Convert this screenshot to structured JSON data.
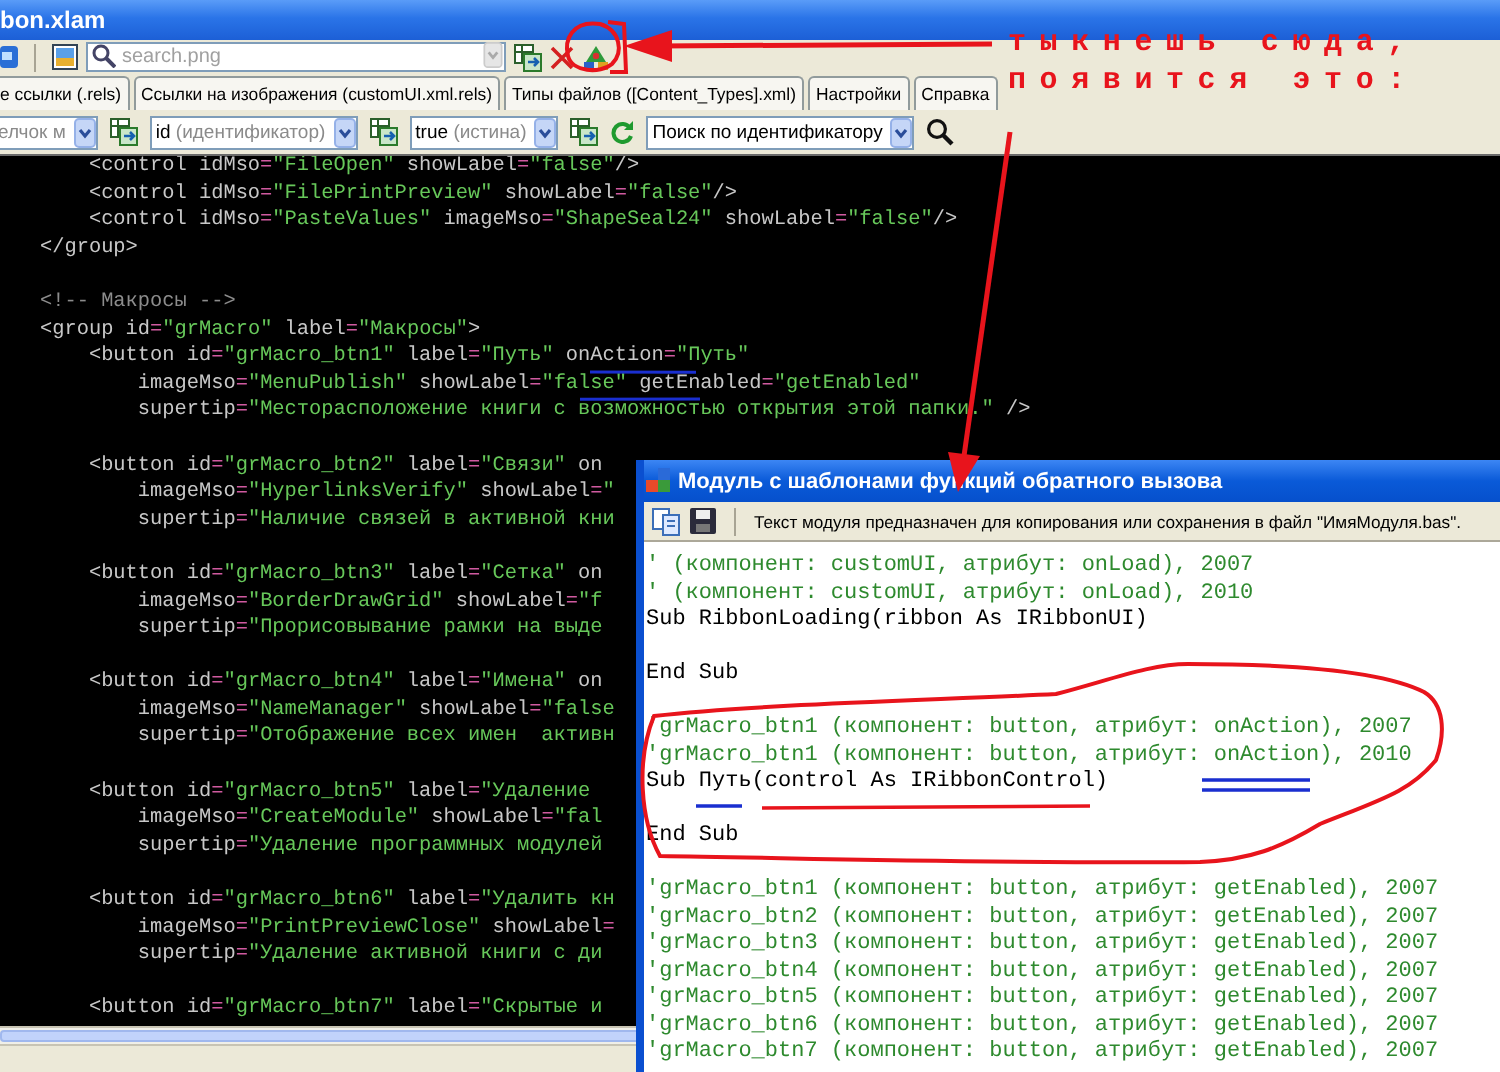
{
  "window": {
    "title": "bon.xlam"
  },
  "toolbar": {
    "search": {
      "placeholder": "search.png"
    }
  },
  "tabs": [
    {
      "label": "е ссылки (.rels)",
      "selected": false
    },
    {
      "label": "Ссылки на изображения (customUI.xml.rels)",
      "selected": false
    },
    {
      "label": "Типы файлов ([Content_Types].xml)",
      "selected": false
    },
    {
      "label": "Настройки",
      "selected": false
    },
    {
      "label": "Справка",
      "selected": false
    }
  ],
  "filters": [
    {
      "hint": "елчок м"
    },
    {
      "value": "id",
      "hint": "(идентификатор)"
    },
    {
      "value": "true",
      "hint": "(истина)"
    },
    {
      "value": "Поиск по идентификатору"
    }
  ],
  "editor": {
    "lines": [
      {
        "kind": "code",
        "text": "    <control idMso=\"FileOpen\" showLabel=\"false\"/>"
      },
      {
        "kind": "code",
        "text": "    <control idMso=\"FilePrintPreview\" showLabel=\"false\"/>"
      },
      {
        "kind": "code",
        "text": "    <control idMso=\"PasteValues\" imageMso=\"ShapeSeal24\" showLabel=\"false\"/>"
      },
      {
        "kind": "code",
        "text": "</group>"
      },
      {
        "kind": "blank"
      },
      {
        "kind": "comment",
        "text": "<!-- Макросы -->"
      },
      {
        "kind": "code",
        "text": "<group id=\"grMacro\" label=\"Макросы\">"
      },
      {
        "kind": "code",
        "text": "    <button id=\"grMacro_btn1\" label=\"Путь\" onAction=\"Путь\""
      },
      {
        "kind": "code",
        "text": "        imageMso=\"MenuPublish\" showLabel=\"false\" getEnabled=\"getEnabled\""
      },
      {
        "kind": "code",
        "text": "        supertip=\"Месторасположение книги с возможностью открытия этой папки.\" />"
      },
      {
        "kind": "blank"
      },
      {
        "kind": "code",
        "text": "    <button id=\"grMacro_btn2\" label=\"Связи\" on"
      },
      {
        "kind": "code",
        "text": "        imageMso=\"HyperlinksVerify\" showLabel=\""
      },
      {
        "kind": "code",
        "text": "        supertip=\"Наличие связей в активной кни"
      },
      {
        "kind": "blank"
      },
      {
        "kind": "code",
        "text": "    <button id=\"grMacro_btn3\" label=\"Сетка\" on"
      },
      {
        "kind": "code",
        "text": "        imageMso=\"BorderDrawGrid\" showLabel=\"f"
      },
      {
        "kind": "code",
        "text": "        supertip=\"Прорисовывание рамки на выде"
      },
      {
        "kind": "blank"
      },
      {
        "kind": "code",
        "text": "    <button id=\"grMacro_btn4\" label=\"Имена\" on"
      },
      {
        "kind": "code",
        "text": "        imageMso=\"NameManager\" showLabel=\"false"
      },
      {
        "kind": "code",
        "text": "        supertip=\"Отображение всех имен  активн"
      },
      {
        "kind": "blank"
      },
      {
        "kind": "code",
        "text": "    <button id=\"grMacro_btn5\" label=\"Удаление"
      },
      {
        "kind": "code",
        "text": "        imageMso=\"CreateModule\" showLabel=\"fal"
      },
      {
        "kind": "code",
        "text": "        supertip=\"Удаление программных модулей"
      },
      {
        "kind": "blank"
      },
      {
        "kind": "code",
        "text": "    <button id=\"grMacro_btn6\" label=\"Удалить кн"
      },
      {
        "kind": "code",
        "text": "        imageMso=\"PrintPreviewClose\" showLabel="
      },
      {
        "kind": "code",
        "text": "        supertip=\"Удаление активной книги с ди"
      },
      {
        "kind": "blank"
      },
      {
        "kind": "code",
        "text": "    <button id=\"grMacro_btn7\" label=\"Скрытые и"
      }
    ]
  },
  "module_window": {
    "title": "Модуль с шаблонами функций обратного вызова",
    "info": "Текст модуля предназначен для копирования или сохранения в файл \"ИмяМодуля.bas\".",
    "lines": [
      {
        "kind": "comment",
        "text": "' (компонент: customUI, атрибут: onLoad), 2007"
      },
      {
        "kind": "comment",
        "text": "' (компонент: customUI, атрибут: onLoad), 2010"
      },
      {
        "kind": "code",
        "text": "Sub RibbonLoading(ribbon As IRibbonUI)"
      },
      {
        "kind": "blank"
      },
      {
        "kind": "code",
        "text": "End Sub"
      },
      {
        "kind": "blank"
      },
      {
        "kind": "comment",
        "text": "'grMacro_btn1 (компонент: button, атрибут: onAction), 2007"
      },
      {
        "kind": "comment",
        "text": "'grMacro_btn1 (компонент: button, атрибут: onAction), 2010"
      },
      {
        "kind": "code",
        "text": "Sub Путь(control As IRibbonControl)"
      },
      {
        "kind": "blank"
      },
      {
        "kind": "code",
        "text": "End Sub"
      },
      {
        "kind": "blank"
      },
      {
        "kind": "comment",
        "text": "'grMacro_btn1 (компонент: button, атрибут: getEnabled), 2007"
      },
      {
        "kind": "comment",
        "text": "'grMacro_btn2 (компонент: button, атрибут: getEnabled), 2007"
      },
      {
        "kind": "comment",
        "text": "'grMacro_btn3 (компонент: button, атрибут: getEnabled), 2007"
      },
      {
        "kind": "comment",
        "text": "'grMacro_btn4 (компонент: button, атрибут: getEnabled), 2007"
      },
      {
        "kind": "comment",
        "text": "'grMacro_btn5 (компонент: button, атрибут: getEnabled), 2007"
      },
      {
        "kind": "comment",
        "text": "'grMacro_btn6 (компонент: button, атрибут: getEnabled), 2007"
      },
      {
        "kind": "comment",
        "text": "'grMacro_btn7 (компонент: button, атрибут: getEnabled), 2007"
      }
    ]
  },
  "annotation": {
    "lines": [
      "тыкнешь сюда,",
      "появится это:"
    ]
  }
}
